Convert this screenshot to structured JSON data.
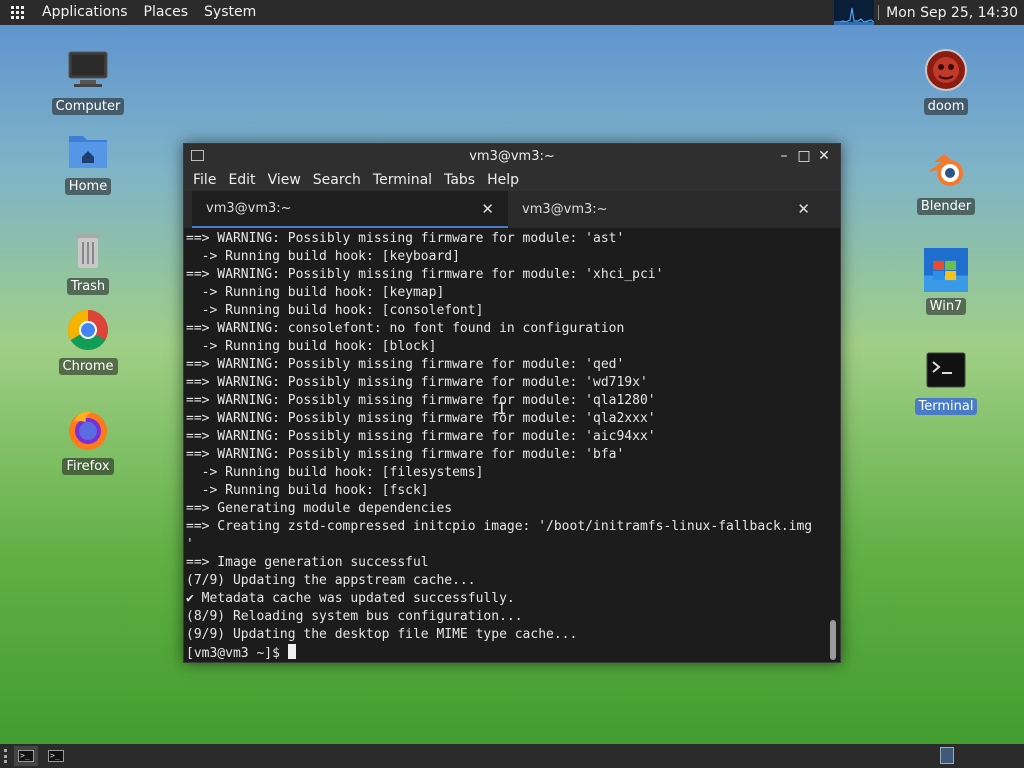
{
  "top_panel": {
    "menu": [
      "Applications",
      "Places",
      "System"
    ],
    "clock": "Mon Sep 25, 14:30"
  },
  "desktop_icons_left": [
    {
      "label": "Computer",
      "icon": "computer-icon"
    },
    {
      "label": "Home",
      "icon": "home-folder-icon"
    },
    {
      "label": "Trash",
      "icon": "trash-icon"
    },
    {
      "label": "Chrome",
      "icon": "chrome-icon"
    },
    {
      "label": "Firefox",
      "icon": "firefox-icon"
    }
  ],
  "desktop_icons_right": [
    {
      "label": "doom",
      "icon": "doom-icon"
    },
    {
      "label": "Blender",
      "icon": "blender-icon"
    },
    {
      "label": "Win7",
      "icon": "windows-icon"
    },
    {
      "label": "Terminal",
      "icon": "terminal-icon",
      "selected": true
    }
  ],
  "window": {
    "title": "vm3@vm3:~",
    "menu": [
      "File",
      "Edit",
      "View",
      "Search",
      "Terminal",
      "Tabs",
      "Help"
    ],
    "tabs": [
      {
        "label": "vm3@vm3:~",
        "active": true
      },
      {
        "label": "vm3@vm3:~",
        "active": false
      }
    ],
    "lines": [
      "==> WARNING: Possibly missing firmware for module: 'ast'",
      "  -> Running build hook: [keyboard]",
      "==> WARNING: Possibly missing firmware for module: 'xhci_pci'",
      "  -> Running build hook: [keymap]",
      "  -> Running build hook: [consolefont]",
      "==> WARNING: consolefont: no font found in configuration",
      "  -> Running build hook: [block]",
      "==> WARNING: Possibly missing firmware for module: 'qed'",
      "==> WARNING: Possibly missing firmware for module: 'wd719x'",
      "==> WARNING: Possibly missing firmware for module: 'qla1280'",
      "==> WARNING: Possibly missing firmware for module: 'qla2xxx'",
      "==> WARNING: Possibly missing firmware for module: 'aic94xx'",
      "==> WARNING: Possibly missing firmware for module: 'bfa'",
      "  -> Running build hook: [filesystems]",
      "  -> Running build hook: [fsck]",
      "==> Generating module dependencies",
      "==> Creating zstd-compressed initcpio image: '/boot/initramfs-linux-fallback.img",
      "'",
      "==> Image generation successful",
      "(7/9) Updating the appstream cache...",
      "✔ Metadata cache was updated successfully.",
      "(8/9) Reloading system bus configuration...",
      "(9/9) Updating the desktop file MIME type cache..."
    ],
    "prompt": "[vm3@vm3 ~]$ "
  },
  "colors": {
    "panel_bg": "#2b2b2b",
    "terminal_bg": "#1c1c1c",
    "accent": "#4a7bc8"
  }
}
